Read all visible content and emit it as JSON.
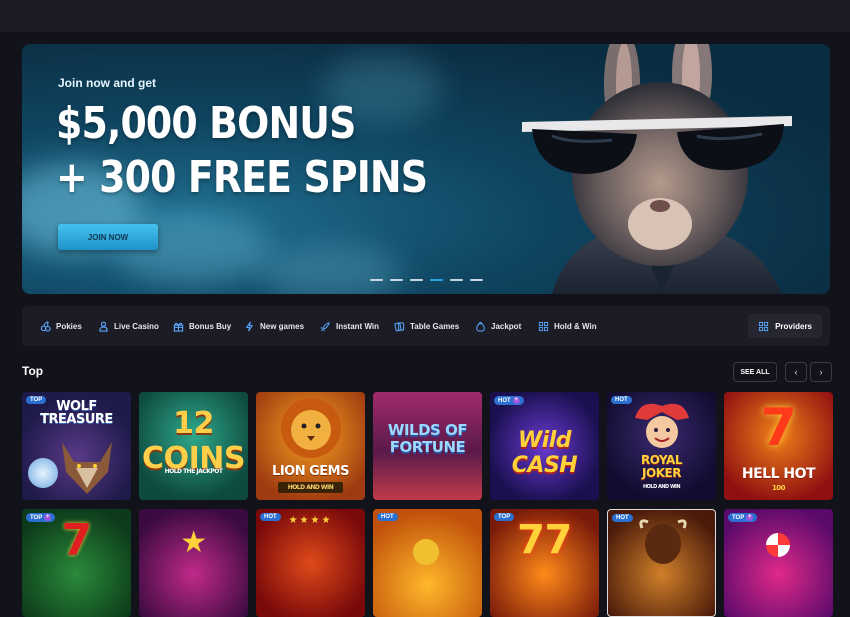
{
  "hero": {
    "kicker": "Join now and get",
    "line1": "$5,000 BONUS",
    "line2": "+ 300 FREE SPINS",
    "cta": "JOIN NOW",
    "slides": 6,
    "active_slide": 4
  },
  "categories": [
    {
      "label": "Pokies",
      "icon": "cherries-icon"
    },
    {
      "label": "Live Casino",
      "icon": "dealer-icon"
    },
    {
      "label": "Bonus Buy",
      "icon": "gift-icon"
    },
    {
      "label": "New games",
      "icon": "lightning-icon"
    },
    {
      "label": "Instant Win",
      "icon": "rocket-icon"
    },
    {
      "label": "Table Games",
      "icon": "cards-icon"
    },
    {
      "label": "Jackpot",
      "icon": "money-bag-icon"
    },
    {
      "label": "Hold & Win",
      "icon": "grid-icon"
    }
  ],
  "providers_label": "Providers",
  "section": {
    "title": "Top",
    "see_all": "SEE ALL",
    "prev": "‹",
    "next": "›"
  },
  "games_row1": [
    {
      "title": "WOLF TREASURE",
      "badge": "TOP",
      "plus": false
    },
    {
      "title": "12 COINS",
      "subtitle": "HOLD THE JACKPOT",
      "badge": "",
      "plus": false
    },
    {
      "title": "LION GEMS",
      "subtitle": "HOLD AND WIN",
      "badge": "",
      "plus": false
    },
    {
      "title": "WILDS OF FORTUNE",
      "badge": "",
      "plus": false
    },
    {
      "title": "Wild CASH",
      "badge": "HOT",
      "plus": true
    },
    {
      "title": "ROYAL JOKER",
      "subtitle": "HOLD AND WIN",
      "badge": "HOT",
      "plus": false
    },
    {
      "title": "HELL HOT",
      "subtitle": "100",
      "badge": "",
      "plus": false
    }
  ],
  "games_row2_badges": [
    "TOP",
    "",
    "HOT",
    "HOT",
    "TOP",
    "HOT",
    "TOP"
  ],
  "colors": {
    "accent": "#2aa5e0",
    "background": "#12121a",
    "panel": "#1c1c26"
  }
}
